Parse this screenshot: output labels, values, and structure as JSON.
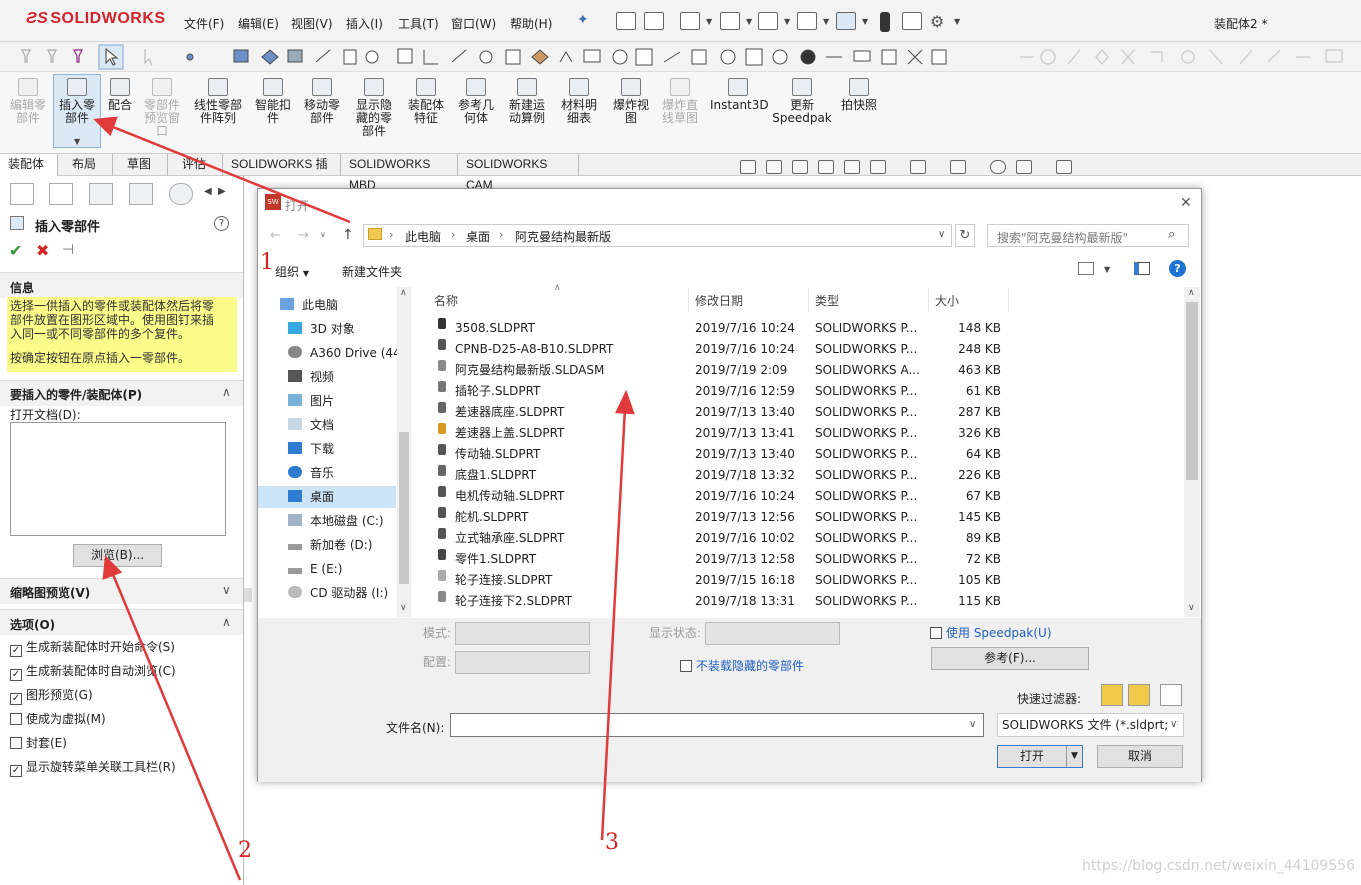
{
  "app": {
    "logo": "SOLIDWORKS",
    "doc_title": "装配体2 *"
  },
  "menus": [
    "文件(F)",
    "编辑(E)",
    "视图(V)",
    "插入(I)",
    "工具(T)",
    "窗口(W)",
    "帮助(H)"
  ],
  "ribbon": [
    {
      "label": "编辑零\n部件",
      "disabled": true
    },
    {
      "label": "插入零\n部件",
      "disabled": false
    },
    {
      "label": "配合",
      "disabled": false
    },
    {
      "label": "零部件\n预览窗\n口",
      "disabled": true
    },
    {
      "label": "线性零部\n件阵列",
      "disabled": false
    },
    {
      "label": "智能扣\n件",
      "disabled": false
    },
    {
      "label": "移动零\n部件",
      "disabled": false
    },
    {
      "label": "显示隐\n藏的零\n部件",
      "disabled": false
    },
    {
      "label": "装配体\n特征",
      "disabled": false
    },
    {
      "label": "参考几\n何体",
      "disabled": false
    },
    {
      "label": "新建运\n动算例",
      "disabled": false
    },
    {
      "label": "材料明\n细表",
      "disabled": false
    },
    {
      "label": "爆炸视\n图",
      "disabled": false
    },
    {
      "label": "爆炸直\n线草图",
      "disabled": true
    },
    {
      "label": "Instant3D",
      "disabled": false
    },
    {
      "label": "更新\nSpeedpak",
      "disabled": false
    },
    {
      "label": "拍快照",
      "disabled": false
    }
  ],
  "tabs": [
    "装配体",
    "布局",
    "草图",
    "评估",
    "SOLIDWORKS 插件",
    "SOLIDWORKS MBD",
    "SOLIDWORKS CAM"
  ],
  "panel": {
    "title": "插入零部件",
    "info_heading": "信息",
    "info_lines": [
      "选择一供插入的零件或装配体然后将零",
      "部件放置在图形区域中。使用图钉来插",
      "入同一或不同零部件的多个复件。"
    ],
    "info_line2": "按确定按钮在原点插入一零部件。",
    "parts_heading": "要插入的零件/装配体(P)",
    "open_docs_label": "打开文档(D):",
    "browse_label": "浏览(B)...",
    "thumb_heading": "缩略图预览(V)",
    "options_heading": "选项(O)",
    "options": [
      {
        "label": "生成新装配体时开始命令(S)",
        "checked": true
      },
      {
        "label": "生成新装配体时自动浏览(C)",
        "checked": true
      },
      {
        "label": "图形预览(G)",
        "checked": true
      },
      {
        "label": "使成为虚拟(M)",
        "checked": false
      },
      {
        "label": "封套(E)",
        "checked": false
      },
      {
        "label": "显示旋转菜单关联工具栏(R)",
        "checked": true
      }
    ]
  },
  "dialog": {
    "title": "打开",
    "breadcrumb": [
      "此电脑",
      "桌面",
      "阿克曼结构最新版"
    ],
    "search_placeholder": "搜索\"阿克曼结构最新版\"",
    "organize": "组织",
    "new_folder": "新建文件夹",
    "nav": [
      "此电脑",
      "3D 对象",
      "A360 Drive (44",
      "视频",
      "图片",
      "文档",
      "下载",
      "音乐",
      "桌面",
      "本地磁盘 (C:)",
      "新加卷 (D:)",
      "E (E:)",
      "CD 驱动器 (I:)"
    ],
    "nav_selected": 8,
    "columns": [
      "名称",
      "修改日期",
      "类型",
      "大小"
    ],
    "files": [
      [
        "3508.SLDPRT",
        "2019/7/16 10:24",
        "SOLIDWORKS P...",
        "148 KB"
      ],
      [
        "CPNB-D25-A8-B10.SLDPRT",
        "2019/7/16 10:24",
        "SOLIDWORKS P...",
        "248 KB"
      ],
      [
        "阿克曼结构最新版.SLDASM",
        "2019/7/19 2:09",
        "SOLIDWORKS A...",
        "463 KB"
      ],
      [
        "插轮子.SLDPRT",
        "2019/7/16 12:59",
        "SOLIDWORKS P...",
        "61 KB"
      ],
      [
        "差速器底座.SLDPRT",
        "2019/7/13 13:40",
        "SOLIDWORKS P...",
        "287 KB"
      ],
      [
        "差速器上盖.SLDPRT",
        "2019/7/13 13:41",
        "SOLIDWORKS P...",
        "326 KB"
      ],
      [
        "传动轴.SLDPRT",
        "2019/7/13 13:40",
        "SOLIDWORKS P...",
        "64 KB"
      ],
      [
        "底盘1.SLDPRT",
        "2019/7/18 13:32",
        "SOLIDWORKS P...",
        "226 KB"
      ],
      [
        "电机传动轴.SLDPRT",
        "2019/7/16 10:24",
        "SOLIDWORKS P...",
        "67 KB"
      ],
      [
        "舵机.SLDPRT",
        "2019/7/13 12:56",
        "SOLIDWORKS P...",
        "145 KB"
      ],
      [
        "立式轴承座.SLDPRT",
        "2019/7/16 10:02",
        "SOLIDWORKS P...",
        "89 KB"
      ],
      [
        "零件1.SLDPRT",
        "2019/7/13 12:58",
        "SOLIDWORKS P...",
        "72 KB"
      ],
      [
        "轮子连接.SLDPRT",
        "2019/7/15 16:18",
        "SOLIDWORKS P...",
        "105 KB"
      ],
      [
        "轮子连接下2.SLDPRT",
        "2019/7/18 13:31",
        "SOLIDWORKS P...",
        "115 KB"
      ]
    ],
    "mode_label": "模式:",
    "config_label": "配置:",
    "display_state_label": "显示状态:",
    "no_hidden_label": "不装载隐藏的零部件",
    "speedpak_label": "使用 Speedpak(U)",
    "ref_button": "参考(F)...",
    "quick_filter_label": "快速过滤器:",
    "filename_label": "文件名(N):",
    "filetype": "SOLIDWORKS 文件 (*.sldprt; *",
    "open_button": "打开",
    "cancel_button": "取消"
  },
  "annotations": [
    "1",
    "2",
    "3"
  ],
  "watermark": "https://blog.csdn.net/weixin_44109556",
  "colors": {
    "accent_red": "#d42626",
    "info_yellow": "#fbfb8a",
    "selection_blue": "#cce4f7",
    "brand_red": "#d2232a"
  }
}
